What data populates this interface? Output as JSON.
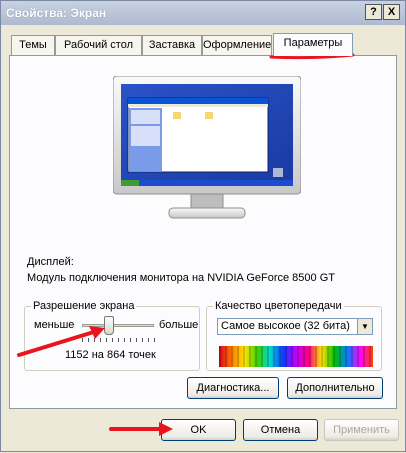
{
  "window": {
    "title": "Свойства: Экран",
    "help_label": "?",
    "close_label": "X"
  },
  "tabs": [
    {
      "label": "Темы"
    },
    {
      "label": "Рабочий стол"
    },
    {
      "label": "Заставка"
    },
    {
      "label": "Оформление"
    },
    {
      "label": "Параметры"
    }
  ],
  "display": {
    "caption": "Дисплей:",
    "device": "Модуль подключения монитора на NVIDIA GeForce 8500 GT"
  },
  "resolution": {
    "legend": "Разрешение экрана",
    "less_label": "меньше",
    "more_label": "больше",
    "value_text": "1152 на 864 точек",
    "slider_position": 0.35
  },
  "color_quality": {
    "legend": "Качество цветопередачи",
    "selected": "Самое высокое (32 бита)",
    "arrow": "▼"
  },
  "buttons": {
    "diagnostics": "Диагностика...",
    "advanced": "Дополнительно",
    "ok": "OK",
    "cancel": "Отмена",
    "apply": "Применить"
  },
  "annotation_color": "#e8141e"
}
